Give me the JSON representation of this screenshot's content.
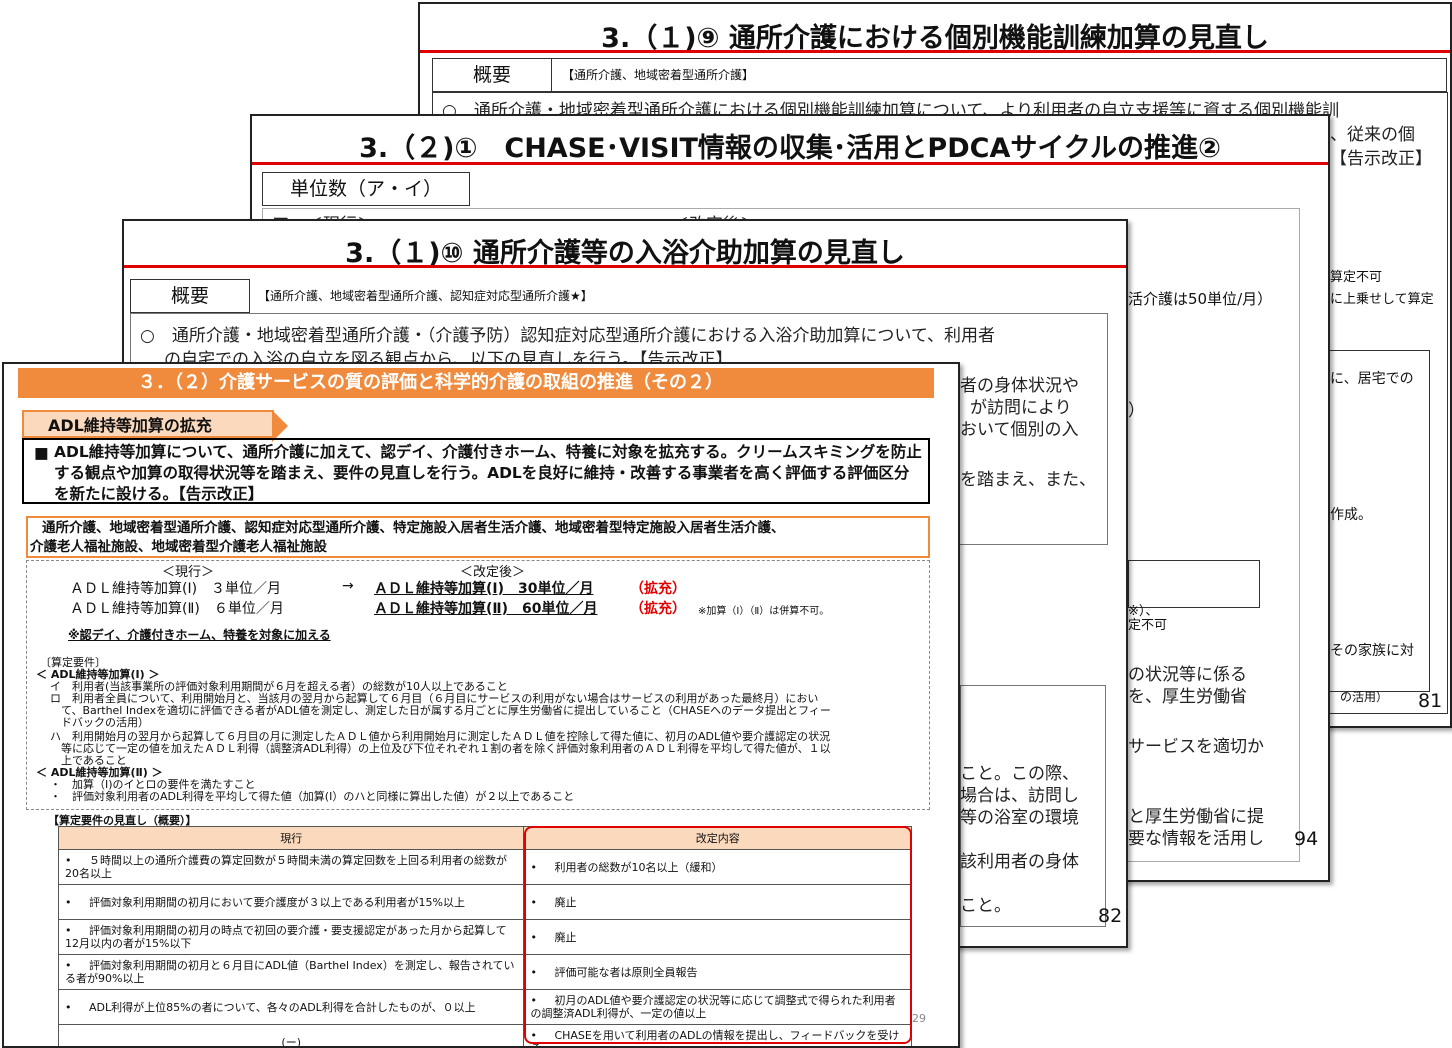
{
  "slide1": {
    "title": "3.（１)⑨ 通所介護における個別機能訓練加算の見直し",
    "overview_label": "概要",
    "services": "【通所介護、地域密着型通所介護】",
    "text_line1": "○　通所介護・地域密着型通所介護における個別機能訓練加算について、より利用者の自立支援等に資する個別機能訓",
    "text_frag1": "、従来の個",
    "text_frag2": "【告示改正】",
    "frag_a": "算定不可",
    "frag_b": "に上乗せして算定",
    "frag_c": "に、居宅での",
    "frag_d": "作成。",
    "frag_e": "その家族に対",
    "frag_f": "の活用）",
    "page_number": "81"
  },
  "slide2": {
    "title": "3.（２)①　CHASE･VISIT情報の収集･活用とPDCAサイクルの推進②",
    "unit_label": "単位数（ア・イ）",
    "frag_current": "ア　＜現行＞",
    "frag_revised": "＜改定後＞",
    "frag_a": "活介護は50単位/月）",
    "frag_b": "）",
    "frag_c": "※）、",
    "frag_d": "定不可",
    "frag_e": "の状況等に係る",
    "frag_f": "を、厚生労働省",
    "frag_g": "サービスを適切か",
    "frag_h": "と厚生労働省に提",
    "frag_i": "要な情報を活用し",
    "page_number": "94"
  },
  "slide3": {
    "title": "3.（１)⑩ 通所介護等の入浴介助加算の見直し",
    "overview_label": "概要",
    "services": "【通所介護、地域密着型通所介護、認知症対応型通所介護★】",
    "text_line1": "○　通所介護・地域密着型通所介護・（介護予防）認知症対応型通所介護における入浴介助加算について、利用者",
    "text_line2": "の自宅での入浴の自立を図る観点から、以下の見直しを行う。【告示改正】",
    "frag_a": "者の身体状況や",
    "frag_b": "が訪問により",
    "frag_c": "おいて個別の入",
    "frag_d": "を踏まえ、また、",
    "frag_e": "こと。この際、",
    "frag_f": "場合は、訪問し",
    "frag_g": "等の浴室の環境",
    "frag_h": "該利用者の身体",
    "frag_i": "こと。",
    "page_number": "82"
  },
  "slide4": {
    "header": "３．（２）介護サービスの質の評価と科学的介護の取組の推進（その２）",
    "tag": "ADL維持等加算の拡充",
    "summary_bullet": "■",
    "summary": "ADL維持等加算について、通所介護に加えて、認デイ、介護付きホーム、特養に対象を拡充する。クリームスキミングを防止する観点や加算の取得状況等を踏まえ、要件の見直しを行う。ADLを良好に維持・改善する事業者を高く評価する評価区分を新たに設ける。【告示改正】",
    "services_line1": "通所介護、地域密着型通所介護、認知症対応型通所介護、特定施設入居者生活介護、地域密着型特定施設入居者生活介護、",
    "services_line2": "介護老人福祉施設、地域密着型介護老人福祉施設",
    "current_label": "＜現行＞",
    "revised_label": "＜改定後＞",
    "row1_current": "ＡＤＬ維持等加算(Ⅰ)　３単位／月",
    "row1_arrow": "→",
    "row1_revised": "ＡＤＬ維持等加算(Ⅰ)　30単位／月",
    "row1_tag": "（拡充）",
    "row2_current": "ＡＤＬ維持等加算(Ⅱ)　６単位／月",
    "row2_revised": "ＡＤＬ維持等加算(Ⅱ)　60単位／月",
    "row2_tag": "（拡充）",
    "row2_note": "※加算（Ⅰ）（Ⅱ）は併算不可。",
    "expand_note": "※認デイ、介護付きホーム、特養を対象に加える",
    "req_heading": "〔算定要件〕",
    "req_i_heading": "＜ ADL維持等加算(Ⅰ) ＞",
    "req_i_a": "イ　利用者(当該事業所の評価対象利用期間が６月を超える者）の総数が10人以上であること",
    "req_i_b1": "ロ　利用者全員について、利用開始月と、当該月の翌月から起算して６月目（６月目にサービスの利用がない場合はサービスの利用があった最終月）におい",
    "req_i_b2": "　て、Barthel Indexを適切に評価できる者がADL値を測定し、測定した日が属する月ごとに厚生労働省に提出していること（CHASEへのデータ提出とフィー",
    "req_i_b3": "　ドバックの活用）",
    "req_i_c1": "ハ　利用開始月の翌月から起算して６月目の月に測定したＡＤＬ値から利用開始月に測定したＡＤＬ値を控除して得た値に、初月のADL値や要介護認定の状況",
    "req_i_c2": "　等に応じて一定の値を加えたＡＤＬ利得（調整済ADL利得）の上位及び下位それぞれ１割の者を除く評価対象利用者のＡＤＬ利得を平均して得た値が、１以",
    "req_i_c3": "　上であること",
    "req_ii_heading": "＜ ADL維持等加算(Ⅱ) ＞",
    "req_ii_a": "・　加算（Ⅰ)のイとロの要件を満たすこと",
    "req_ii_b": "・　評価対象利用者のADL利得を平均して得た値（加算(Ⅰ）のハと同様に算出した値）が２以上であること",
    "review_heading": "【算定要件の見直し（概要）】",
    "table": {
      "col_current": "現行",
      "col_revised": "改定内容",
      "bullet": "•",
      "rows": [
        {
          "current": "５時間以上の通所介護費の算定回数が５時間未満の算定回数を上回る利用者の総数が20名以上",
          "revised": "利用者の総数が10名以上（緩和）"
        },
        {
          "current": "評価対象利用期間の初月において要介護度が３以上である利用者が15%以上",
          "revised": "廃止"
        },
        {
          "current": "評価対象利用期間の初月の時点で初回の要介護・要支援認定があった月から起算して12月以内の者が15%以下",
          "revised": "廃止"
        },
        {
          "current": "評価対象利用期間の初月と６月目にADL値（Barthel Index）を測定し、報告されている者が90%以上",
          "revised": "評価可能な者は原則全員報告"
        },
        {
          "current": "ADL利得が上位85%の者について、各々のADL利得を合計したものが、０以上",
          "revised": "初月のADL値や要介護認定の状況等に応じて調整式で得られた利用者の調整済ADL利得が、一定の値以上"
        },
        {
          "current": "(ー)",
          "revised": "CHASEを用いて利用者のADLの情報を提出し、フィードバックを受ける"
        }
      ]
    },
    "page_number": "29"
  }
}
